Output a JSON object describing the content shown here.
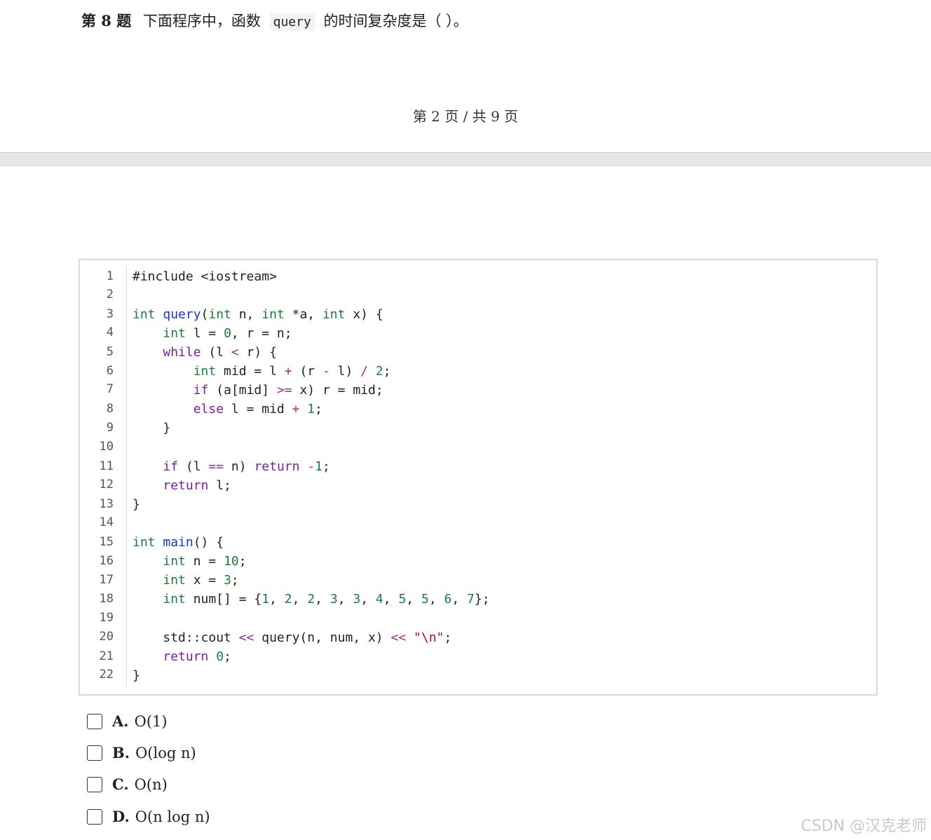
{
  "question": {
    "number": "第 8 题",
    "text_before": "下面程序中，函数",
    "code_word": "query",
    "text_after": "的时间复杂度是（ ）。"
  },
  "page_info": "第 2 页 / 共 9 页",
  "code": {
    "line_numbers": [
      "1",
      "2",
      "3",
      "4",
      "5",
      "6",
      "7",
      "8",
      "9",
      "10",
      "11",
      "12",
      "13",
      "14",
      "15",
      "16",
      "17",
      "18",
      "19",
      "20",
      "21",
      "22"
    ]
  },
  "options": [
    {
      "letter": "A.",
      "expr": "O(1)"
    },
    {
      "letter": "B.",
      "expr": "O(log n)"
    },
    {
      "letter": "C.",
      "expr": "O(n)"
    },
    {
      "letter": "D.",
      "expr": "O(n log n)"
    }
  ],
  "watermark": "CSDN @汉克老师"
}
